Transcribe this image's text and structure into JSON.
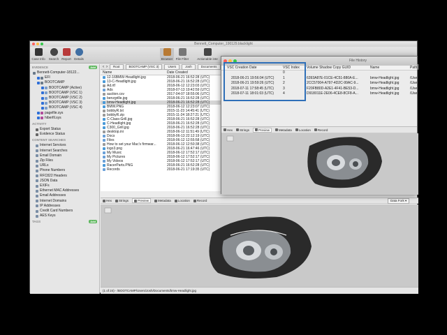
{
  "window": {
    "title": "Bennett_Computer_190129.blacklight"
  },
  "toolbar": {
    "left": [
      {
        "label": "Case Info",
        "icon": "case-info-icon",
        "color": "#333333"
      },
      {
        "label": "Search",
        "icon": "search-icon",
        "color": "#444444"
      },
      {
        "label": "Report",
        "icon": "report-icon",
        "color": "#b83a3a"
      },
      {
        "label": "Details",
        "icon": "details-icon",
        "color": "#3f6ea3"
      }
    ],
    "center": [
      {
        "label": "Browser",
        "icon": "browser-icon",
        "color": "#b87a33"
      },
      {
        "label": "File Filter",
        "icon": "file-filter-icon",
        "color": "#777777"
      },
      {
        "label": "Actionable inte",
        "icon": "actionable-intel-icon",
        "color": "#444444"
      }
    ]
  },
  "sidebar": {
    "evidence_header": "EVIDENCE",
    "add_label": "Add",
    "evidence": [
      {
        "label": "Bennett-Computer-18122...",
        "level": 0
      },
      {
        "label": "EFI",
        "level": 1
      },
      {
        "label": "BOOTCAMP",
        "level": 1
      },
      {
        "label": "BOOTCAMP (Active)",
        "level": 2
      },
      {
        "label": "BOOTCAMP (VSC 1)",
        "level": 2
      },
      {
        "label": "BOOTCAMP (VSC 2)",
        "level": 2
      },
      {
        "label": "BOOTCAMP (VSC 3)",
        "level": 2
      },
      {
        "label": "BOOTCAMP (VSC 4)",
        "level": 2
      },
      {
        "label": "pagefile.sys",
        "level": 1
      },
      {
        "label": "hiberfil.sys",
        "level": 1
      }
    ],
    "activity_header": "ACTIVITY",
    "activity": [
      "Export Status",
      "Evidence Status"
    ],
    "content_header": "CONTENT SEARCHES",
    "content": [
      "Internet Services",
      "Internet Searches",
      "Email Domain",
      "Zip Files",
      "URLs",
      "Phone Numbers",
      "RFC822 Headers",
      "JSON Data",
      "EXIFs",
      "Ethernet MAC Addresses",
      "Email Addresses",
      "Internet Domains",
      "IP Addresses",
      "Credit Card Numbers",
      "AES Keys"
    ],
    "tags_header": "TAGS",
    "tags_add": "Add"
  },
  "breadcrumb": [
    "Root",
    "BOOTCAMP (VSC 3)",
    "Users",
    "Josh",
    "Documents"
  ],
  "file_list": {
    "col_name": "Name",
    "col_date": "Date Created",
    "rows": [
      {
        "name": "12-16BMW-Headlight.jpg",
        "date": "2018-06-21 16:52:28 (UTC)",
        "type": "img"
      },
      {
        "name": "13-C-Headlight.jpg",
        "date": "2018-06-21 16:52:28 (UTC)",
        "type": "img"
      },
      {
        "name": "Ad.rtf",
        "date": "2018-06-12 12:23:03 (UTC)",
        "type": "doc"
      },
      {
        "name": "Ads",
        "date": "2018-07-13 19:42:59 (UTC)",
        "type": "folder"
      },
      {
        "name": "auction.csv",
        "date": "2017-04-07 18:55:06 (UTC)",
        "type": "doc"
      },
      {
        "name": "benzgrille.jpg",
        "date": "2018-06-21 16:52:28 (UTC)",
        "type": "img"
      },
      {
        "name": "bmw-Headlight.jpg",
        "date": "2018-06-21 16:52:28 (UTC)",
        "type": "img",
        "selected": true
      },
      {
        "name": "BMW.PNG",
        "date": "2018-06-12 12:23:07 (UTC)",
        "type": "img"
      },
      {
        "name": "bobbyR.txt",
        "date": "2015-11-23 14:45:41 (UTC)",
        "type": "doc"
      },
      {
        "name": "bobbyR.zip",
        "date": "2015-11-24 18:27:21 (UTC)",
        "type": "doc"
      },
      {
        "name": "C-Class-Grill.jpg",
        "date": "2018-06-21 16:52:28 (UTC)",
        "type": "img"
      },
      {
        "name": "C-Headlight.jpg",
        "date": "2018-06-21 16:52:28 (UTC)",
        "type": "img"
      },
      {
        "name": "C300_Grill.jpg",
        "date": "2018-06-21 16:52:28 (UTC)",
        "type": "img"
      },
      {
        "name": "desktop.ini",
        "date": "2018-06-12 11:51:49 (UTC)",
        "type": "doc"
      },
      {
        "name": "Docs",
        "date": "2018-06-13 22:12:19 (UTC)",
        "type": "folder"
      },
      {
        "name": "Files",
        "date": "2018-06-12 12:55:58 (UTC)",
        "type": "folder"
      },
      {
        "name": "How to set your Mac's firmwar...",
        "date": "2018-06-12 12:50:38 (UTC)",
        "type": "doc"
      },
      {
        "name": "logo3.png",
        "date": "2018-06-21 16:47:46 (UTC)",
        "type": "img"
      },
      {
        "name": "My Music",
        "date": "2018-06-12 17:52:17 (UTC)",
        "type": "folder"
      },
      {
        "name": "My Pictures",
        "date": "2018-06-12 17:52:17 (UTC)",
        "type": "folder"
      },
      {
        "name": "My Videos",
        "date": "2018-06-12 17:52:17 (UTC)",
        "type": "folder"
      },
      {
        "name": "RacerParts.PNG",
        "date": "2018-06-21 16:52:28 (UTC)",
        "type": "img"
      },
      {
        "name": "Records",
        "date": "2018-06-21 17:19:35 (UTC)",
        "type": "folder"
      }
    ]
  },
  "view_tabs": [
    "Hex",
    "Strings",
    "Preview",
    "Metadata",
    "Location",
    "Record"
  ],
  "data_fork": "Data Fork",
  "status_text": "(1 of 24) - /BOOTCAMP/Users/Josh/Documents/bmw-Headlight.jpg",
  "file_history": {
    "title": "File History",
    "columns": [
      "VSC Creation Date",
      "VSC Index",
      "Volume Shadow Copy GUID",
      "Name",
      "Path"
    ],
    "rows": [
      {
        "date": "",
        "index": "0",
        "guid": "",
        "name": "",
        "path": ""
      },
      {
        "date": "2018-06-21 19:56:04 (UTC)",
        "index": "1",
        "guid": "6393A87E-01CE-4C51-880A-E...",
        "name": "bmw-Headlight.jpg",
        "path": "/Use"
      },
      {
        "date": "2018-06-21 19:59:26 (UTC)",
        "index": "2",
        "guid": "2CC57004-A797-4D2C-99AC-9...",
        "name": "bmw-Headlight.jpg",
        "path": "/Use"
      },
      {
        "date": "2018-07-11 17:58:45 (UTC)",
        "index": "3",
        "guid": "F20FB80D-A2E1-4F41-BE53-D...",
        "name": "bmw-Headlight.jpg",
        "path": "/Use"
      },
      {
        "date": "2018-07-11 18:01:03 (UTC)",
        "index": "4",
        "guid": "D918011E-2E06-4CE8-8CF8-A...",
        "name": "bmw-Headlight.jpg",
        "path": "/Use"
      }
    ]
  },
  "colors": {
    "accent": "#2e6fb8",
    "add_green": "#5fb85f",
    "selection": "#d6d6d6"
  }
}
